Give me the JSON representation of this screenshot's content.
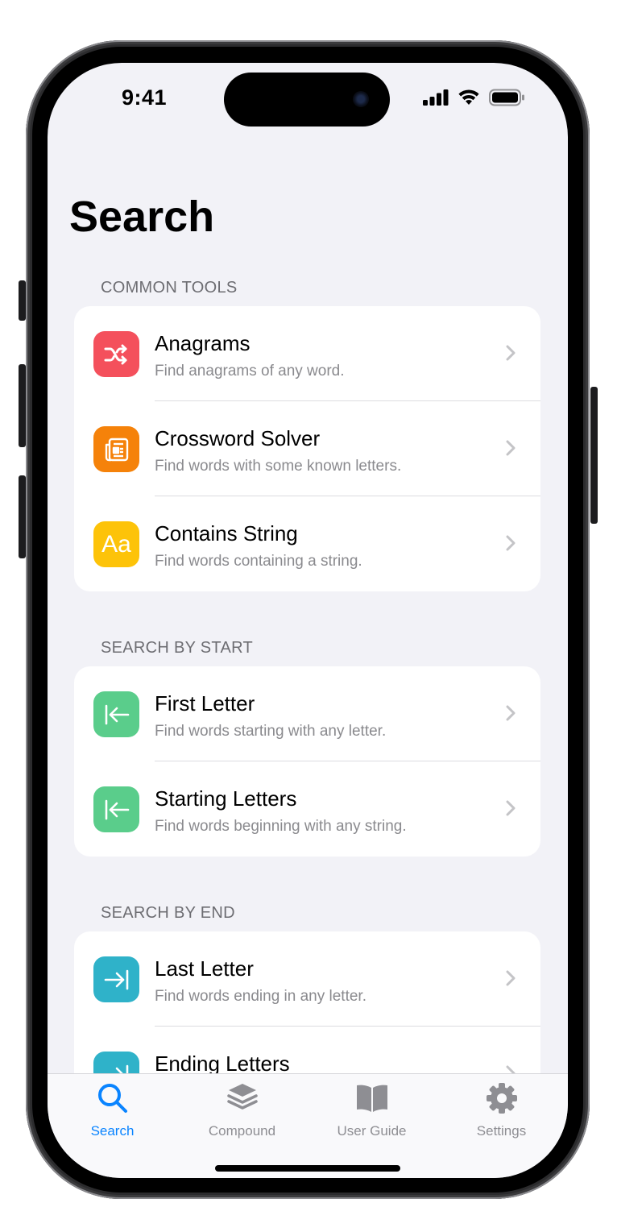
{
  "status_bar": {
    "time": "9:41"
  },
  "page": {
    "title": "Search"
  },
  "sections": [
    {
      "header": "COMMON TOOLS",
      "items": [
        {
          "title": "Anagrams",
          "subtitle": "Find anagrams of any word.",
          "icon": "shuffle-icon",
          "color": "#f4505c"
        },
        {
          "title": "Crossword Solver",
          "subtitle": "Find words with some known letters.",
          "icon": "newspaper-icon",
          "color": "#f5820a"
        },
        {
          "title": "Contains String",
          "subtitle": "Find words containing a string.",
          "icon": "text-aa-icon",
          "icon_text": "Aa",
          "color": "#fdc309"
        }
      ]
    },
    {
      "header": "SEARCH BY START",
      "items": [
        {
          "title": "First Letter",
          "subtitle": "Find words starting with any letter.",
          "icon": "arrow-left-to-line-icon",
          "color": "#5acd8b"
        },
        {
          "title": "Starting Letters",
          "subtitle": "Find words beginning with any string.",
          "icon": "arrow-left-to-line-icon",
          "color": "#5acd8b"
        }
      ]
    },
    {
      "header": "SEARCH BY END",
      "items": [
        {
          "title": "Last Letter",
          "subtitle": "Find words ending in any letter.",
          "icon": "arrow-right-to-line-icon",
          "color": "#2fb2c9"
        },
        {
          "title": "Ending Letters",
          "subtitle": "",
          "icon": "arrow-right-to-line-icon",
          "color": "#2fb2c9"
        }
      ]
    }
  ],
  "tabbar": {
    "tabs": [
      {
        "label": "Search",
        "icon": "magnifying-glass-icon",
        "active": true
      },
      {
        "label": "Compound",
        "icon": "layers-icon",
        "active": false
      },
      {
        "label": "User Guide",
        "icon": "book-icon",
        "active": false
      },
      {
        "label": "Settings",
        "icon": "gear-icon",
        "active": false
      }
    ]
  },
  "colors": {
    "accent": "#0a84ff",
    "inactive_tab": "#8e8e93",
    "background": "#f2f2f7"
  }
}
